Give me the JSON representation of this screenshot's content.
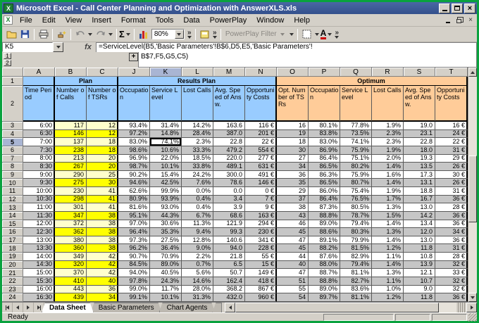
{
  "window": {
    "title": "Microsoft Excel - Call Center Planning and Optimization with AnswerXLS.xls"
  },
  "menu": {
    "items": [
      "File",
      "Edit",
      "View",
      "Insert",
      "Format",
      "Tools",
      "Data",
      "PowerPlay",
      "Window",
      "Help"
    ]
  },
  "toolbar": {
    "zoom_value": "80%",
    "sum_label": "Σ",
    "powerplay_filter_label": "PowerPlay Filter",
    "font_color_label": "A",
    "overflow_chevron": "»"
  },
  "formula_bar": {
    "name_box": "K5",
    "fx_label": "fx",
    "formula_line1": "=ServiceLevel(B5,'Basic Parameters'!B$6,D5,E5,'Basic Parameters'!",
    "formula_line2": "B$7,F5,G5,C5)"
  },
  "outline": {
    "level1": "1",
    "level2": "2",
    "expand_button": "+"
  },
  "sheet": {
    "columns": [
      "A",
      "B",
      "C",
      "J",
      "K",
      "L",
      "M",
      "N",
      "O",
      "P",
      "Q",
      "R",
      "S",
      "T"
    ],
    "selected_column": "K",
    "selected_row": 5,
    "selected_cell_ref": "K5",
    "selected_cell_value": "74.1%",
    "groups": [
      {
        "label": "",
        "span": 1,
        "color": "blue"
      },
      {
        "label": "Plan",
        "span": 2,
        "color": "blue"
      },
      {
        "label": "Results Plan",
        "span": 5,
        "color": "blue"
      },
      {
        "label": "Optimum",
        "span": 6,
        "color": "orange"
      }
    ],
    "group_row_number": "1",
    "label_row_number": "2",
    "col_headers": [
      "Time Period",
      "Number of Calls",
      "Number of TSRs",
      "Occupation",
      "Service Level",
      "Lost Calls",
      "Avg. Speed of Answ.",
      "Opportunity Costs",
      "Opt. Number of TSRs",
      "Occupation",
      "Service Level",
      "Lost Calls",
      "Avg. Speed of Answ.",
      "Opportunity Costs"
    ],
    "rows": [
      {
        "n": 3,
        "cells": [
          "6:00",
          "117",
          "12",
          "93.4%",
          "31.4%",
          "14.2%",
          "163.6",
          "116 €",
          "16",
          "80.1%",
          "77.8%",
          "1.9%",
          "19.0",
          "16 €"
        ]
      },
      {
        "n": 4,
        "cells": [
          "6:30",
          "146",
          "12",
          "97.2%",
          "14.8%",
          "28.4%",
          "387.0",
          "201 €",
          "19",
          "83.8%",
          "73.5%",
          "2.3%",
          "23.1",
          "24 €"
        ]
      },
      {
        "n": 5,
        "cells": [
          "7:00",
          "137",
          "18",
          "83.0%",
          "74.1%",
          "2.3%",
          "22.8",
          "22 €",
          "18",
          "83.0%",
          "74.1%",
          "2.3%",
          "22.8",
          "22 €"
        ]
      },
      {
        "n": 6,
        "cells": [
          "7:30",
          "238",
          "18",
          "98.6%",
          "10.6%",
          "33.3%",
          "479.2",
          "554 €",
          "30",
          "86.9%",
          "75.9%",
          "1.9%",
          "18.0",
          "31 €"
        ]
      },
      {
        "n": 7,
        "cells": [
          "8:00",
          "213",
          "20",
          "96.9%",
          "22.0%",
          "18.5%",
          "220.0",
          "277 €",
          "27",
          "86.4%",
          "75.1%",
          "2.0%",
          "19.3",
          "29 €"
        ]
      },
      {
        "n": 8,
        "cells": [
          "8:30",
          "267",
          "20",
          "98.7%",
          "10.1%",
          "33.8%",
          "489.1",
          "631 €",
          "34",
          "86.5%",
          "80.2%",
          "1.4%",
          "13.5",
          "26 €"
        ]
      },
      {
        "n": 9,
        "cells": [
          "9:00",
          "290",
          "25",
          "90.2%",
          "15.4%",
          "24.2%",
          "300.0",
          "491 €",
          "36",
          "86.3%",
          "75.9%",
          "1.6%",
          "17.3",
          "30 €"
        ]
      },
      {
        "n": 10,
        "cells": [
          "9:30",
          "275",
          "30",
          "94.6%",
          "42.5%",
          "7.6%",
          "78.6",
          "146 €",
          "35",
          "86.5%",
          "80.7%",
          "1.4%",
          "13.1",
          "26 €"
        ]
      },
      {
        "n": 11,
        "cells": [
          "10:00",
          "230",
          "41",
          "62.6%",
          "99.9%",
          "0.0%",
          "0.0",
          "0 €",
          "29",
          "86.0%",
          "75.4%",
          "1.9%",
          "18.8",
          "31 €"
        ]
      },
      {
        "n": 12,
        "cells": [
          "10:30",
          "298",
          "41",
          "80.9%",
          "93.9%",
          "0.4%",
          "3.4",
          "7 €",
          "37",
          "86.4%",
          "76.5%",
          "1.7%",
          "16.7",
          "36 €"
        ]
      },
      {
        "n": 13,
        "cells": [
          "11:00",
          "301",
          "41",
          "81.6%",
          "93.0%",
          "0.4%",
          "3.9",
          "9 €",
          "38",
          "87.3%",
          "80.5%",
          "1.3%",
          "13.0",
          "28 €"
        ]
      },
      {
        "n": 14,
        "cells": [
          "11:30",
          "347",
          "38",
          "95.1%",
          "44.3%",
          "6.7%",
          "68.6",
          "163 €",
          "43",
          "88.8%",
          "78.7%",
          "1.5%",
          "14.2",
          "36 €"
        ]
      },
      {
        "n": 15,
        "cells": [
          "12:00",
          "372",
          "38",
          "97.0%",
          "30.6%",
          "11.3%",
          "121.9",
          "294 €",
          "46",
          "89.0%",
          "79.4%",
          "1.4%",
          "13.4",
          "36 €"
        ]
      },
      {
        "n": 16,
        "cells": [
          "12:30",
          "362",
          "38",
          "96.4%",
          "35.3%",
          "9.4%",
          "99.3",
          "230 €",
          "45",
          "88.6%",
          "80.3%",
          "1.3%",
          "12.0",
          "34 €"
        ]
      },
      {
        "n": 17,
        "cells": [
          "13:00",
          "380",
          "38",
          "97.3%",
          "27.5%",
          "12.8%",
          "140.6",
          "341 €",
          "47",
          "89.1%",
          "79.9%",
          "1.4%",
          "13.0",
          "36 €"
        ]
      },
      {
        "n": 18,
        "cells": [
          "13:30",
          "360",
          "38",
          "96.2%",
          "36.4%",
          "9.0%",
          "94.0",
          "228 €",
          "45",
          "88.2%",
          "81.5%",
          "1.2%",
          "11.8",
          "31 €"
        ]
      },
      {
        "n": 19,
        "cells": [
          "14:00",
          "349",
          "42",
          "90.7%",
          "70.9%",
          "2.2%",
          "21.8",
          "55 €",
          "44",
          "87.6%",
          "82.9%",
          "1.1%",
          "10.8",
          "28 €"
        ]
      },
      {
        "n": 20,
        "cells": [
          "14:30",
          "320",
          "42",
          "84.5%",
          "89.0%",
          "0.7%",
          "6.5",
          "15 €",
          "40",
          "88.0%",
          "79.4%",
          "1.4%",
          "13.9",
          "32 €"
        ]
      },
      {
        "n": 21,
        "cells": [
          "15:00",
          "370",
          "42",
          "94.0%",
          "40.5%",
          "5.6%",
          "50.7",
          "149 €",
          "47",
          "88.7%",
          "81.1%",
          "1.3%",
          "12.1",
          "33 €"
        ]
      },
      {
        "n": 22,
        "cells": [
          "15:30",
          "410",
          "40",
          "97.8%",
          "24.3%",
          "14.6%",
          "162.4",
          "418 €",
          "51",
          "88.8%",
          "82.7%",
          "1.1%",
          "10.7",
          "32 €"
        ]
      },
      {
        "n": 23,
        "cells": [
          "16:00",
          "443",
          "36",
          "99.0%",
          "11.7%",
          "28.0%",
          "368.2",
          "867 €",
          "55",
          "89.0%",
          "83.6%",
          "1.0%",
          "9.0",
          "32 €"
        ]
      },
      {
        "n": 24,
        "cells": [
          "16:30",
          "439",
          "34",
          "99.1%",
          "10.1%",
          "31.3%",
          "432.0",
          "960 €",
          "54",
          "89.7%",
          "81.1%",
          "1.2%",
          "11.8",
          "36 €"
        ]
      }
    ]
  },
  "tabs": {
    "items": [
      {
        "label": "Data Sheet",
        "active": true
      },
      {
        "label": "Basic Parameters",
        "active": false
      },
      {
        "label": "Chart Agents",
        "active": false
      }
    ]
  },
  "status": {
    "text": "Ready"
  },
  "colors": {
    "frame_green": "#09A23E",
    "titlebar_blue": "#33508C",
    "header_blue": "#99CCFF",
    "optimum_orange": "#FFCC99",
    "calls_yellow_bright": "#FFFF00",
    "calls_yellow_pale": "#FFFFCC",
    "row_alt_gray": "#C6C6C6"
  }
}
